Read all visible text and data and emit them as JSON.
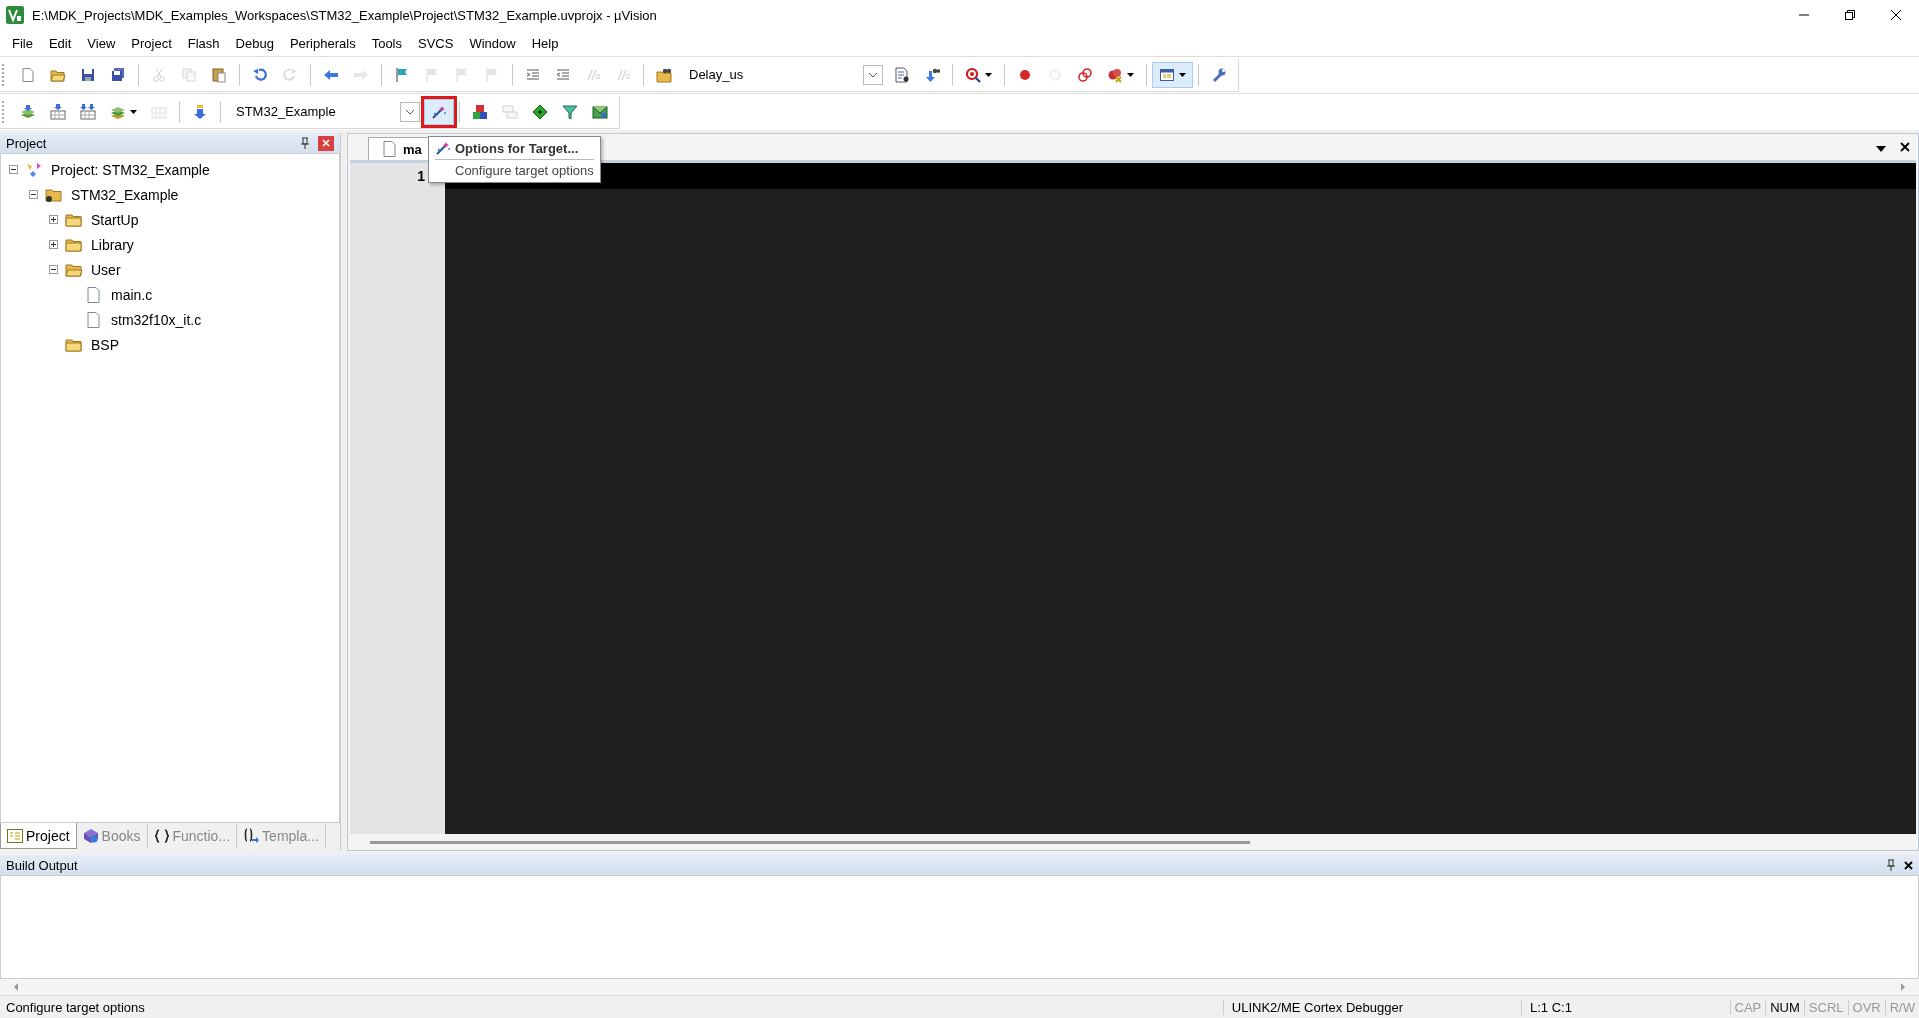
{
  "window": {
    "title": "E:\\MDK_Projects\\MDK_Examples_Workspaces\\STM32_Example\\Project\\STM32_Example.uvprojx - µVision"
  },
  "menu": [
    "File",
    "Edit",
    "View",
    "Project",
    "Flash",
    "Debug",
    "Peripherals",
    "Tools",
    "SVCS",
    "Window",
    "Help"
  ],
  "toolbar_1": [
    {
      "kind": "button",
      "disabled": false,
      "on": false
    },
    {
      "kind": "button",
      "disabled": false,
      "on": false
    },
    {
      "kind": "button",
      "disabled": false,
      "on": false
    },
    {
      "kind": "button",
      "disabled": false,
      "on": false
    },
    {
      "kind": "separator"
    },
    {
      "kind": "button",
      "disabled": true,
      "on": false
    },
    {
      "kind": "button",
      "disabled": true,
      "on": false
    },
    {
      "kind": "button",
      "disabled": false,
      "on": false
    },
    {
      "kind": "separator"
    },
    {
      "kind": "button",
      "disabled": false,
      "on": false
    },
    {
      "kind": "button",
      "disabled": true,
      "on": false
    },
    {
      "kind": "separator"
    },
    {
      "kind": "button",
      "disabled": false,
      "on": false
    },
    {
      "kind": "button",
      "disabled": true,
      "on": false
    },
    {
      "kind": "separator"
    },
    {
      "kind": "button",
      "disabled": false,
      "on": false
    },
    {
      "kind": "button",
      "disabled": true,
      "on": false
    },
    {
      "kind": "button",
      "disabled": true,
      "on": false
    },
    {
      "kind": "button",
      "disabled": true,
      "on": false
    },
    {
      "kind": "separator"
    },
    {
      "kind": "button",
      "disabled": false,
      "on": false
    },
    {
      "kind": "button",
      "disabled": false,
      "on": false
    },
    {
      "kind": "button",
      "disabled": true,
      "on": false
    },
    {
      "kind": "button",
      "disabled": true,
      "on": false
    },
    {
      "kind": "separator"
    },
    {
      "kind": "button",
      "disabled": false,
      "on": false
    },
    {
      "kind": "combo",
      "value": "Delay_us"
    },
    {
      "kind": "button",
      "disabled": false,
      "on": false
    },
    {
      "kind": "button",
      "disabled": false,
      "on": false
    },
    {
      "kind": "separator"
    },
    {
      "kind": "split",
      "disabled": false,
      "on": false
    },
    {
      "kind": "separator"
    },
    {
      "kind": "button",
      "disabled": false,
      "on": false
    },
    {
      "kind": "button",
      "disabled": true,
      "on": false
    },
    {
      "kind": "button",
      "disabled": false,
      "on": false
    },
    {
      "kind": "split",
      "disabled": false,
      "on": false
    },
    {
      "kind": "separator"
    },
    {
      "kind": "split",
      "disabled": false,
      "on": true
    },
    {
      "kind": "separator"
    },
    {
      "kind": "button",
      "disabled": false,
      "on": false
    }
  ],
  "toolbar_2": [
    {
      "kind": "button",
      "disabled": false,
      "on": false,
      "outlined": false
    },
    {
      "kind": "button",
      "disabled": false,
      "on": false,
      "outlined": false
    },
    {
      "kind": "button",
      "disabled": false,
      "on": false,
      "outlined": false
    },
    {
      "kind": "split",
      "disabled": false,
      "on": false,
      "outlined": false
    },
    {
      "kind": "button",
      "disabled": true,
      "on": false,
      "outlined": false
    },
    {
      "kind": "separator"
    },
    {
      "kind": "button",
      "disabled": false,
      "on": false,
      "outlined": false
    },
    {
      "kind": "separator"
    },
    {
      "kind": "combo",
      "value": "STM32_Example"
    },
    {
      "kind": "button",
      "disabled": false,
      "on": true,
      "outlined": true
    },
    {
      "kind": "separator"
    },
    {
      "kind": "button",
      "disabled": false,
      "on": false,
      "outlined": false
    },
    {
      "kind": "button",
      "disabled": true,
      "on": false,
      "outlined": false
    },
    {
      "kind": "button",
      "disabled": false,
      "on": false,
      "outlined": false
    },
    {
      "kind": "button",
      "disabled": false,
      "on": false,
      "outlined": false
    },
    {
      "kind": "button",
      "disabled": false,
      "on": false,
      "outlined": false
    }
  ],
  "tooltip": {
    "title": "Options for Target...",
    "description": "Configure target options"
  },
  "project_panel": {
    "title": "Project",
    "tree": [
      {
        "label": "Project: STM32_Example",
        "kind": "project",
        "expanded": true,
        "children": [
          {
            "label": "STM32_Example",
            "kind": "target",
            "expanded": true,
            "children": [
              {
                "label": "StartUp",
                "kind": "folder",
                "expanded": false
              },
              {
                "label": "Library",
                "kind": "folder",
                "expanded": false
              },
              {
                "label": "User",
                "kind": "folder",
                "expanded": true,
                "children": [
                  {
                    "label": "main.c",
                    "kind": "file"
                  },
                  {
                    "label": "stm32f10x_it.c",
                    "kind": "file"
                  }
                ]
              },
              {
                "label": "BSP",
                "kind": "folder"
              }
            ]
          }
        ]
      }
    ],
    "tabs": [
      {
        "label": "Project",
        "selected": true
      },
      {
        "label": "Books",
        "selected": false
      },
      {
        "label": "Functio...",
        "selected": false
      },
      {
        "label": "Templa...",
        "selected": false
      }
    ]
  },
  "editor": {
    "tab": "ma",
    "line_numbers": [
      "1"
    ]
  },
  "build_output": {
    "title": "Build Output"
  },
  "status_bar": {
    "message": "Configure target options",
    "debugger": "ULINK2/ME Cortex Debugger",
    "position": "L:1 C:1",
    "indicators": [
      {
        "label": "CAP",
        "on": false
      },
      {
        "label": "NUM",
        "on": true
      },
      {
        "label": "SCRL",
        "on": false
      },
      {
        "label": "OVR",
        "on": false
      },
      {
        "label": "R/W",
        "on": false
      }
    ]
  }
}
